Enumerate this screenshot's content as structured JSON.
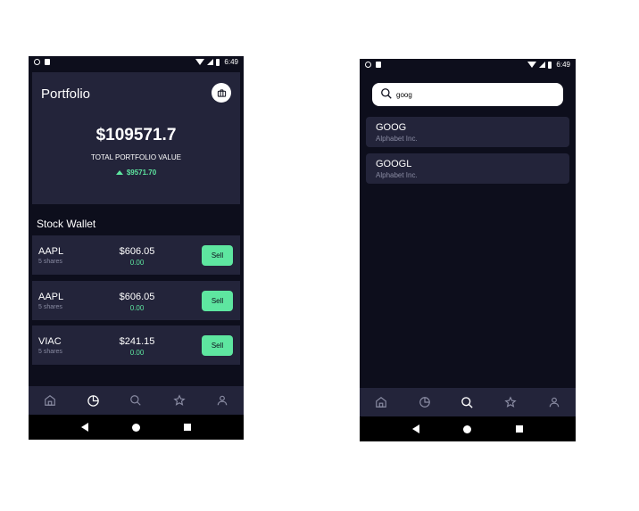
{
  "status_bar": {
    "time": "6:49"
  },
  "portfolio": {
    "title": "Portfolio",
    "total_value": "$109571.7",
    "total_label": "TOTAL PORTFOLIO VALUE",
    "change": "$9571.70"
  },
  "wallet": {
    "title": "Stock Wallet",
    "stocks": [
      {
        "symbol": "AAPL",
        "shares": "5 shares",
        "price": "$606.05",
        "change": "0.00",
        "sell_label": "Sell"
      },
      {
        "symbol": "AAPL",
        "shares": "5 shares",
        "price": "$606.05",
        "change": "0.00",
        "sell_label": "Sell"
      },
      {
        "symbol": "VIAC",
        "shares": "5 shares",
        "price": "$241.15",
        "change": "0.00",
        "sell_label": "Sell"
      }
    ]
  },
  "search": {
    "query": "goog",
    "results": [
      {
        "symbol": "GOOG",
        "name": "Alphabet Inc."
      },
      {
        "symbol": "GOOGL",
        "name": "Alphabet Inc."
      }
    ]
  },
  "nav": {
    "icons": [
      "home-icon",
      "pie-chart-icon",
      "search-icon",
      "star-icon",
      "user-icon"
    ],
    "active_left": "pie-chart-icon",
    "active_right": "search-icon"
  },
  "colors": {
    "background": "#0d0e1c",
    "card": "#23243a",
    "accent_green": "#5ee6a0",
    "muted_text": "#8a8ca3"
  }
}
